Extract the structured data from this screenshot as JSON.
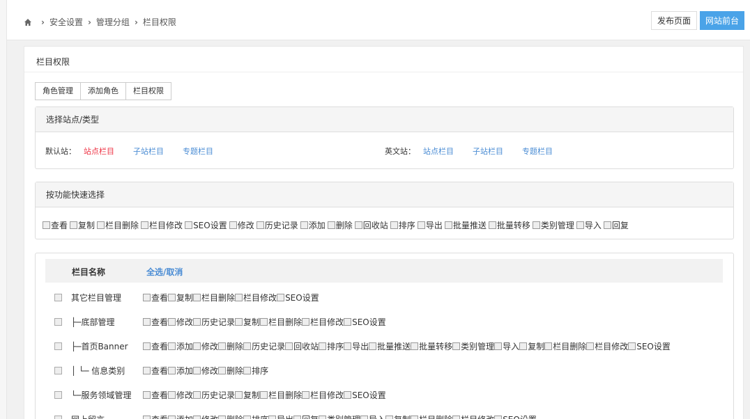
{
  "breadcrumb": {
    "items": [
      "安全设置",
      "管理分组",
      "栏目权限"
    ]
  },
  "header": {
    "publish_label": "发布页面",
    "front_label": "网站前台"
  },
  "panel": {
    "title": "栏目权限"
  },
  "tabs": [
    {
      "label": "角色管理"
    },
    {
      "label": "添加角色"
    },
    {
      "label": "栏目权限"
    }
  ],
  "site_select": {
    "title": "选择站点/类型",
    "sites": [
      {
        "label": "默认站：",
        "links": [
          "站点栏目",
          "子站栏目",
          "专题栏目"
        ]
      },
      {
        "label": "英文站：",
        "links": [
          "站点栏目",
          "子站栏目",
          "专题栏目"
        ]
      }
    ]
  },
  "quick_select": {
    "title": "按功能快速选择",
    "items": [
      "查看",
      "复制",
      "栏目删除",
      "栏目修改",
      "SEO设置",
      "修改",
      "历史记录",
      "添加",
      "删除",
      "回收站",
      "排序",
      "导出",
      "批量推送",
      "批量转移",
      "类别管理",
      "导入",
      "回复"
    ]
  },
  "table": {
    "col_name": "栏目名称",
    "select_all": "全选",
    "slash": "/",
    "cancel": "取消",
    "rows": [
      {
        "name": "其它栏目管理",
        "perms": [
          "查看",
          "复制",
          "栏目删除",
          "栏目修改",
          "SEO设置"
        ]
      },
      {
        "name": "├─底部管理",
        "perms": [
          "查看",
          "修改",
          "历史记录",
          "复制",
          "栏目删除",
          "栏目修改",
          "SEO设置"
        ]
      },
      {
        "name": "├─首页Banner",
        "perms": [
          "查看",
          "添加",
          "修改",
          "删除",
          "历史记录",
          "回收站",
          "排序",
          "导出",
          "批量推送",
          "批量转移",
          "类别管理",
          "导入",
          "复制",
          "栏目删除",
          "栏目修改",
          "SEO设置"
        ]
      },
      {
        "name": "│ └─ 信息类别",
        "perms": [
          "查看",
          "添加",
          "修改",
          "删除",
          "排序"
        ]
      },
      {
        "name": "└─服务领域管理",
        "perms": [
          "查看",
          "修改",
          "历史记录",
          "复制",
          "栏目删除",
          "栏目修改",
          "SEO设置"
        ]
      },
      {
        "name": "网上留言",
        "perms": [
          "查看",
          "添加",
          "修改",
          "删除",
          "排序",
          "导出",
          "回复",
          "类别管理",
          "导入",
          "复制",
          "栏目删除",
          "栏目修改",
          "SEO设置"
        ]
      }
    ]
  }
}
